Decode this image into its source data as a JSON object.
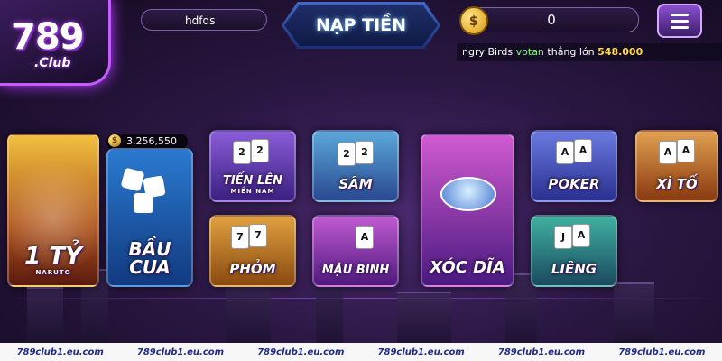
{
  "logo": {
    "number": "789",
    "suffix": ".Club"
  },
  "header": {
    "username": "hdfds",
    "deposit_label": "NẠP TIỀN",
    "coin_symbol": "$",
    "balance": "0"
  },
  "ticker": {
    "prefix": "ngry Birds",
    "user": "votan",
    "text": "thắng lớn",
    "amount": "548.000"
  },
  "jackpot": {
    "symbol": "$",
    "value": "3,256,550"
  },
  "games": [
    {
      "id": "naruto",
      "label": "1 TỶ",
      "sub": "NARUTO"
    },
    {
      "id": "bau-cua",
      "label": "BẦU CUA",
      "sub": ""
    },
    {
      "id": "tien-len",
      "label": "TIẾN LÊN",
      "sub": "MIỀN NAM"
    },
    {
      "id": "sam",
      "label": "SÂM",
      "sub": ""
    },
    {
      "id": "xoc-dia",
      "label": "XÓC DĨA",
      "sub": ""
    },
    {
      "id": "poker",
      "label": "POKER",
      "sub": ""
    },
    {
      "id": "xi-to",
      "label": "XÌ TỐ",
      "sub": ""
    },
    {
      "id": "phom",
      "label": "PHỎM",
      "sub": ""
    },
    {
      "id": "mau-binh",
      "label": "MẬU BINH",
      "sub": ""
    },
    {
      "id": "lieng",
      "label": "LIÊNG",
      "sub": ""
    }
  ],
  "footer": {
    "watermarks": [
      "789club1.eu.com",
      "789club1.eu.com",
      "789club1.eu.com",
      "789club1.eu.com",
      "789club1.eu.com",
      "789club1.eu.com"
    ]
  },
  "colors": {
    "accent": "#c65bff",
    "win_user": "#7dff7a",
    "win_amount": "#ffd84a",
    "footer_text": "#1f2a8a"
  }
}
